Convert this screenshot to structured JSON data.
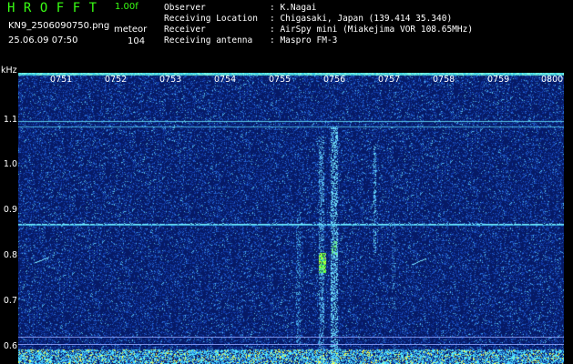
{
  "header": {
    "app_title": "HROFFT",
    "version": "1.00f",
    "filename": "KN9_2506090750.png",
    "meteor_label": "meteor",
    "datetime": "25.06.09 07:50",
    "meteor_count": "104"
  },
  "info": [
    {
      "key": "Observer",
      "value": ": K.Nagai"
    },
    {
      "key": "Receiving Location",
      "value": ": Chigasaki, Japan (139.414 35.340)"
    },
    {
      "key": "Receiver",
      "value": ": AirSpy mini (Miakejima VOR 108.65MHz)"
    },
    {
      "key": "Receiving antenna",
      "value": ": Maspro FM-3"
    }
  ],
  "axis": {
    "y_unit": "kHz",
    "y_ticks": [
      "1.1",
      "1.0",
      "0.9",
      "0.8",
      "0.7",
      "0.6"
    ],
    "x_ticks": [
      "0751",
      "0752",
      "0753",
      "0754",
      "0755",
      "0756",
      "0757",
      "0758",
      "0759",
      "0800"
    ]
  },
  "colors": {
    "background": "#000000",
    "spectrogram_bg": "#061a66",
    "title_green": "#39ff14",
    "signal_cyan": "#7ff5ff",
    "signal_green": "#5cff4a",
    "signal_yellow": "#ffff3c"
  }
}
